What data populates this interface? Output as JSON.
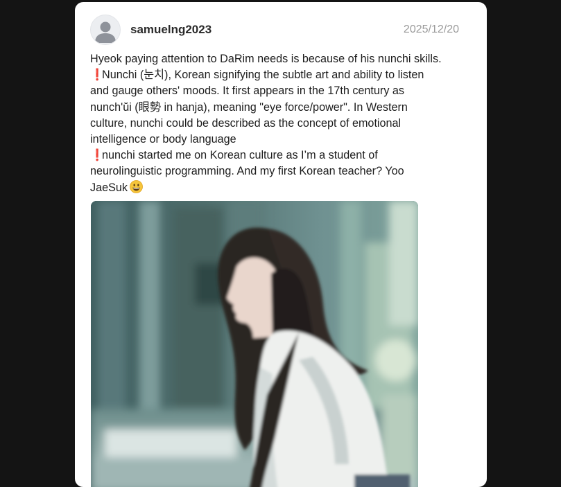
{
  "post": {
    "username": "samuelng2023",
    "date": "2025/12/20",
    "lines": [
      "Hyeok paying attention to DaRim needs is because of his nunchi skills.",
      "Nunchi (눈치), Korean signifying the subtle art and ability to listen",
      "and gauge others' moods. It first appears in the 17th century as",
      "nunch'ŭi (眼勢 in hanja), meaning \"eye force/power\". In Western",
      "culture, nunchi could be described as the concept of emotional",
      "intelligence or body language",
      "nunchi started me on Korean culture as I’m a student of",
      "neurolinguistic programming. And my first Korean teacher? Yoo",
      "JaeSuk"
    ],
    "exclamation": "❗"
  },
  "icons": {
    "avatar": "default-user-avatar",
    "exclamation": "red-exclamation-icon",
    "emoji": "grinning-face-emoji"
  },
  "colors": {
    "background": "#141414",
    "card": "#ffffff",
    "username": "#2a2a2a",
    "date": "#9a9a9a",
    "text": "#1d1d1d",
    "exclamation": "#e0261c"
  }
}
